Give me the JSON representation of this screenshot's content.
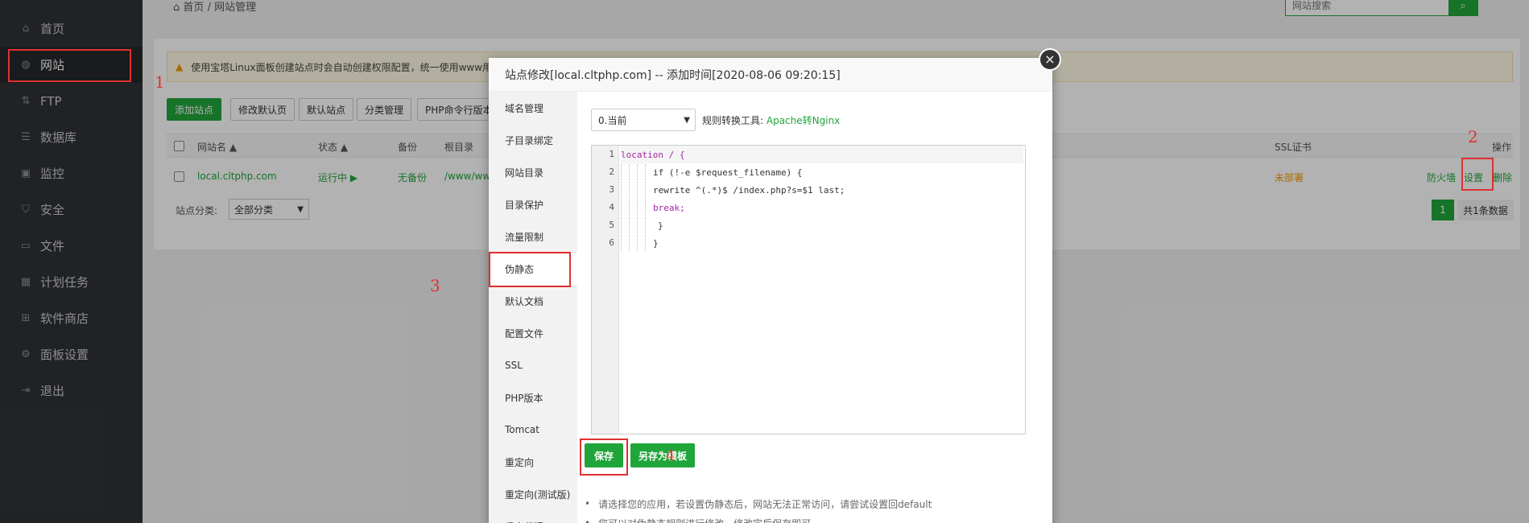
{
  "sidebar": {
    "items": [
      {
        "label": "首页",
        "icon": "home-icon"
      },
      {
        "label": "网站",
        "icon": "globe-icon"
      },
      {
        "label": "FTP",
        "icon": "ftp-icon"
      },
      {
        "label": "数据库",
        "icon": "database-icon"
      },
      {
        "label": "监控",
        "icon": "monitor-icon"
      },
      {
        "label": "安全",
        "icon": "shield-icon"
      },
      {
        "label": "文件",
        "icon": "folder-icon"
      },
      {
        "label": "计划任务",
        "icon": "calendar-icon"
      },
      {
        "label": "软件商店",
        "icon": "grid-icon"
      },
      {
        "label": "面板设置",
        "icon": "gear-icon"
      },
      {
        "label": "退出",
        "icon": "logout-icon"
      }
    ],
    "active": "网站"
  },
  "header": {
    "breadcrumb_home": "首页",
    "breadcrumb_sep": "/",
    "breadcrumb_current": "网站管理",
    "search_placeholder": "网站搜索"
  },
  "notice": {
    "text": "使用宝塔Linux面板创建站点时会自动创建权限配置，统一使用www用"
  },
  "toolbar": {
    "add_site": "添加站点",
    "edit_default_page": "修改默认页",
    "default_site": "默认站点",
    "category_manage": "分类管理",
    "php_cli": "PHP命令行版本"
  },
  "table": {
    "headers": {
      "name": "网站名 ▲",
      "status": "状态 ▲",
      "backup": "备份",
      "root": "根目录",
      "ssl": "SSL证书",
      "ops": "操作"
    },
    "rows": [
      {
        "name": "local.cltphp.com",
        "status": "运行中 ▶",
        "backup": "无备份",
        "root": "/www/ww",
        "ssl": "未部署",
        "firewall": "防火墙",
        "settings": "设置",
        "delete": "删除"
      }
    ]
  },
  "footer": {
    "category_label": "站点分类:",
    "category_value": "全部分类",
    "page": "1",
    "total": "共1条数据"
  },
  "annotations": [
    "1",
    "2",
    "3",
    "4"
  ],
  "modal": {
    "title": "站点修改[local.cltphp.com] -- 添加时间[2020-08-06 09:20:15]",
    "close": "×",
    "tabs": [
      "域名管理",
      "子目录绑定",
      "网站目录",
      "目录保护",
      "流量限制",
      "伪静态",
      "默认文档",
      "配置文件",
      "SSL",
      "PHP版本",
      "Tomcat",
      "重定向",
      "重定向(测试版)",
      "反向代理"
    ],
    "active_tab": "伪静态",
    "version_select": "0.当前",
    "convert_label": "规则转换工具:",
    "convert_link": "Apache转Nginx",
    "code_lines": [
      {
        "num": "1",
        "text": "location / {"
      },
      {
        "num": "2",
        "text": "if (!-e $request_filename) {"
      },
      {
        "num": "3",
        "text": "rewrite ^(.*)$ /index.php?s=$1 last;"
      },
      {
        "num": "4",
        "text": "break;"
      },
      {
        "num": "5",
        "text": "}"
      },
      {
        "num": "6",
        "text": "}"
      }
    ],
    "save": "保存",
    "save_as_template": "另存为模板",
    "tips": [
      "请选择您的应用，若设置伪静态后，网站无法正常访问，请尝试设置回default",
      "您可以对伪静态规则进行修改，修改完后保存即可。"
    ]
  },
  "colors": {
    "accent": "#20a53a",
    "annotation": "#e03030",
    "sidebar": "#2f3235",
    "warning": "#f09b00"
  }
}
